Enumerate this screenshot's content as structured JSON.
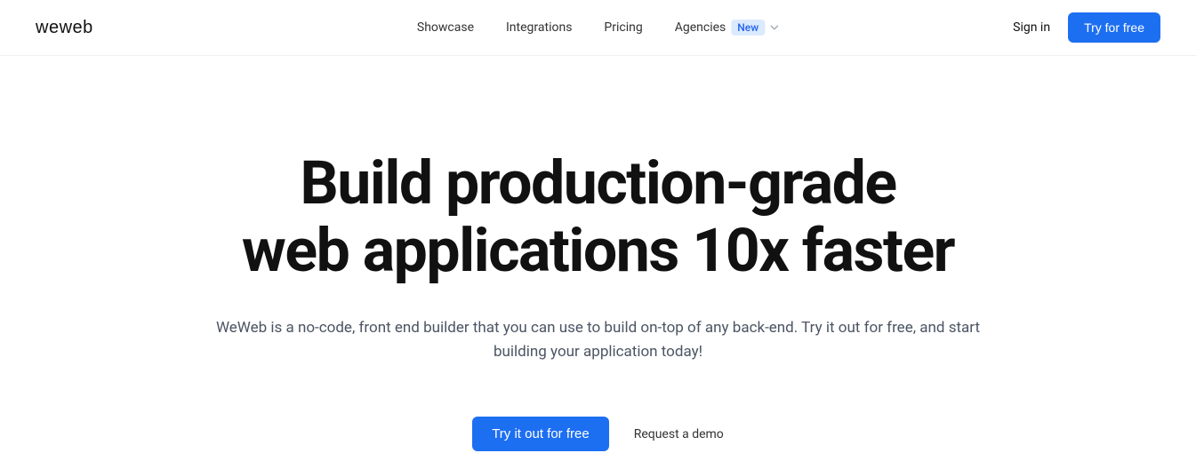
{
  "brand": {
    "name": "weweb"
  },
  "nav": {
    "items": [
      {
        "label": "Showcase"
      },
      {
        "label": "Integrations"
      },
      {
        "label": "Pricing"
      },
      {
        "label": "Agencies",
        "badge": "New",
        "dropdown": true
      }
    ]
  },
  "header": {
    "signin_label": "Sign in",
    "cta_label": "Try for free"
  },
  "hero": {
    "title_line1": "Build production-grade",
    "title_line2": "web applications 10x faster",
    "subtitle": "WeWeb is a no-code, front end builder that you can use to build on-top of any back-end. Try it out for free, and start building your application today!",
    "cta_primary": "Try it out for free",
    "cta_secondary": "Request a demo"
  },
  "colors": {
    "primary": "#1d6ff2",
    "badge_bg": "#dbeafe",
    "badge_text": "#2563eb",
    "text": "#111827",
    "subtext": "#4b5563"
  }
}
